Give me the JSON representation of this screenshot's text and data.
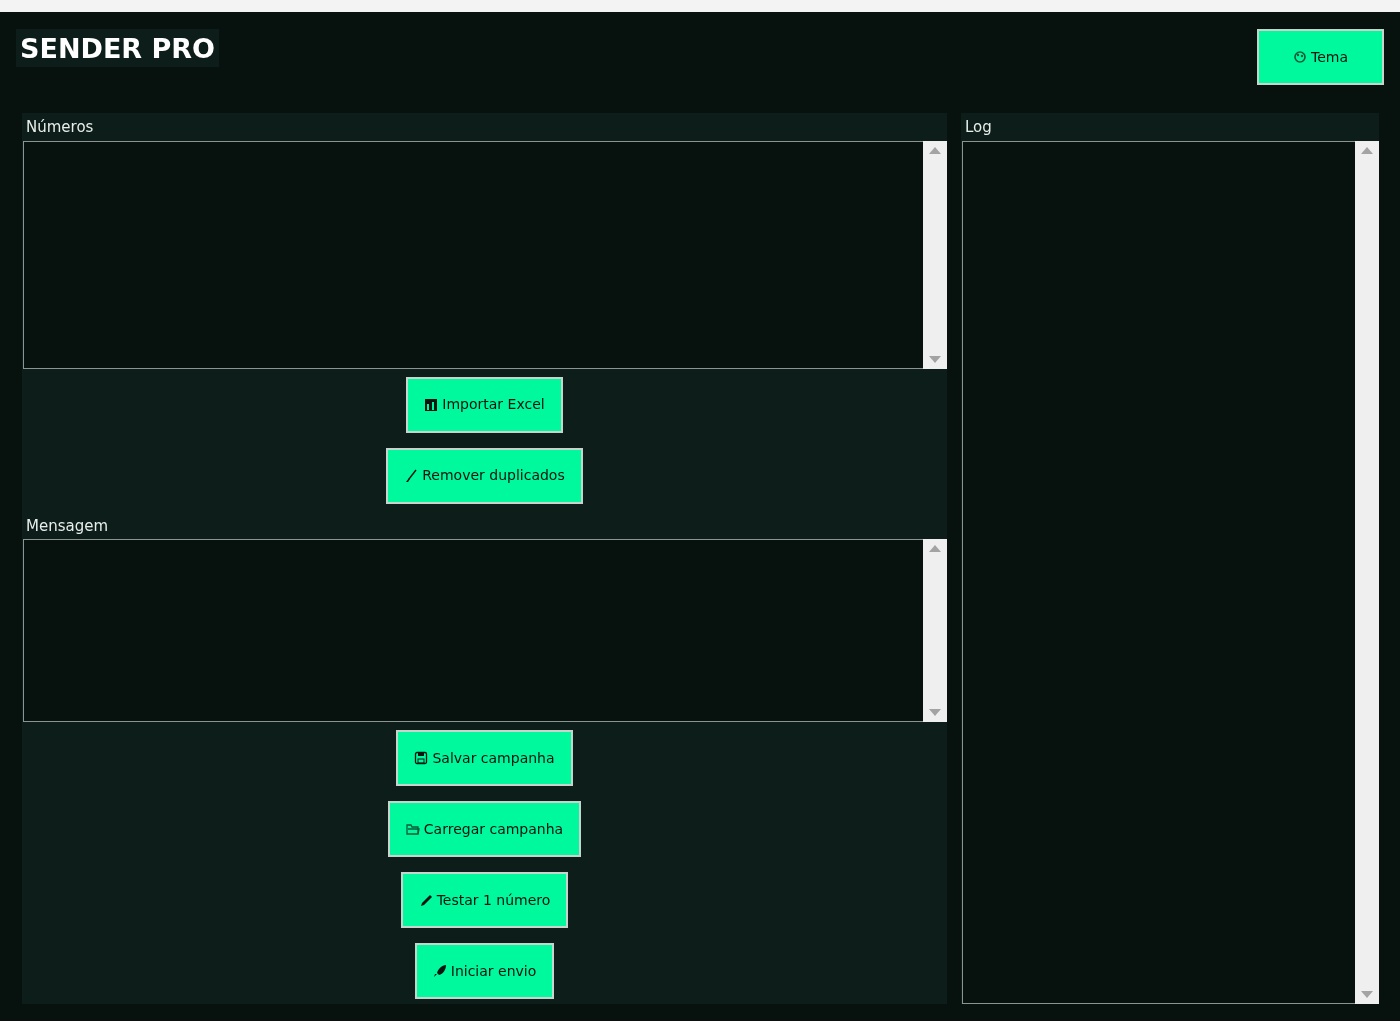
{
  "title": "SENDER PRO",
  "theme_button": {
    "label": "Tema",
    "kind": "palette"
  },
  "left_sections": [
    {
      "label": "Números",
      "buttons": [
        {
          "label": "Importar Excel",
          "kind": "chart"
        },
        {
          "label": "Remover duplicados",
          "kind": "brush"
        }
      ]
    },
    {
      "label": "Mensagem",
      "buttons": [
        {
          "label": "Salvar campanha",
          "kind": "floppy"
        },
        {
          "label": "Carregar campanha",
          "kind": "folder"
        },
        {
          "label": "Testar 1 número",
          "kind": "pen"
        },
        {
          "label": "Iniciar envio",
          "kind": "rocket"
        }
      ]
    }
  ],
  "log": {
    "label": "Log"
  }
}
